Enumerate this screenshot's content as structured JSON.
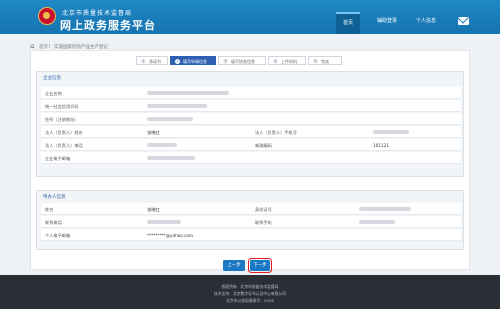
{
  "header": {
    "subtitle": "北京市质量技术监督局",
    "title": "网上政务服务平台",
    "nav": [
      {
        "label": "首页",
        "active": true
      },
      {
        "label": "辅助登录",
        "active": false
      },
      {
        "label": "个人信息",
        "active": false
      }
    ],
    "mail_icon": "mail-icon"
  },
  "breadcrumb": {
    "home_icon": "home-icon",
    "items": [
      "首页",
      "实施国家检验产品生产登记"
    ]
  },
  "steps": [
    {
      "num": "1",
      "label": "承诺书",
      "active": false
    },
    {
      "num": "2",
      "label": "填写申请信息",
      "active": true
    },
    {
      "num": "3",
      "label": "填写核准信息",
      "active": false
    },
    {
      "num": "4",
      "label": "上传材料",
      "active": false
    },
    {
      "num": "5",
      "label": "完成",
      "active": false
    }
  ],
  "enterprise": {
    "title": "企业信息",
    "rows": [
      {
        "label": "企业名称"
      },
      {
        "label": "统一社会信用代码"
      },
      {
        "label": "住所（注册地址）"
      },
      {
        "label": "法人（负责人）姓名",
        "value": "张晓红",
        "label2": "法人（负责人）手机号"
      },
      {
        "label": "法人（负责人）电话",
        "label2": "邮政编码",
        "value2": "101121"
      },
      {
        "label": "企业电子邮箱"
      }
    ]
  },
  "agent": {
    "title": "申办人信息",
    "rows": [
      {
        "label": "姓名",
        "value": "张晓红",
        "label2": "身份证号"
      },
      {
        "label": "联系电话",
        "label2": "联系手机"
      },
      {
        "label": "个人电子邮箱",
        "value": "*********@yahoo.com"
      }
    ]
  },
  "buttons": {
    "prev": "上一步",
    "next": "下一步"
  },
  "footer": {
    "lines": [
      "版权所有：北京市质量技术监督局",
      "技术支持：北京数字证书认证中心有限公司",
      "北京市公安局备案号：0358"
    ]
  },
  "colors": {
    "header": "#1674b0",
    "step_active": "#2d5fb3",
    "button": "#1b78c4",
    "highlight": "#e3191f",
    "footer": "#2a2f36"
  }
}
